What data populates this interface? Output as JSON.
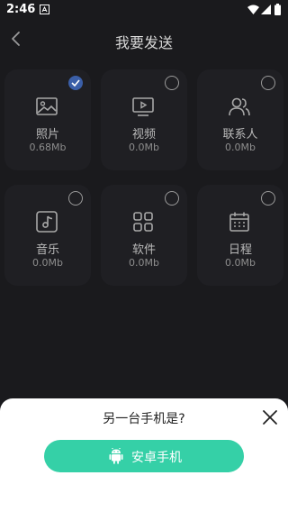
{
  "status_bar": {
    "time": "2:46"
  },
  "header": {
    "title": "我要发送"
  },
  "items": [
    {
      "label": "照片",
      "size": "0.68Mb",
      "icon": "image-icon",
      "checked": true
    },
    {
      "label": "视频",
      "size": "0.0Mb",
      "icon": "video-icon",
      "checked": false
    },
    {
      "label": "联系人",
      "size": "0.0Mb",
      "icon": "contacts-icon",
      "checked": false
    },
    {
      "label": "音乐",
      "size": "0.0Mb",
      "icon": "music-icon",
      "checked": false
    },
    {
      "label": "软件",
      "size": "0.0Mb",
      "icon": "apps-icon",
      "checked": false
    },
    {
      "label": "日程",
      "size": "0.0Mb",
      "icon": "calendar-icon",
      "checked": false
    }
  ],
  "sheet": {
    "question": "另一台手机是?",
    "button_label": "安卓手机"
  },
  "colors": {
    "background": "#1a1a1d",
    "card": "#1f1f23",
    "accent": "#35d0a7",
    "check": "#3b5fa8"
  }
}
